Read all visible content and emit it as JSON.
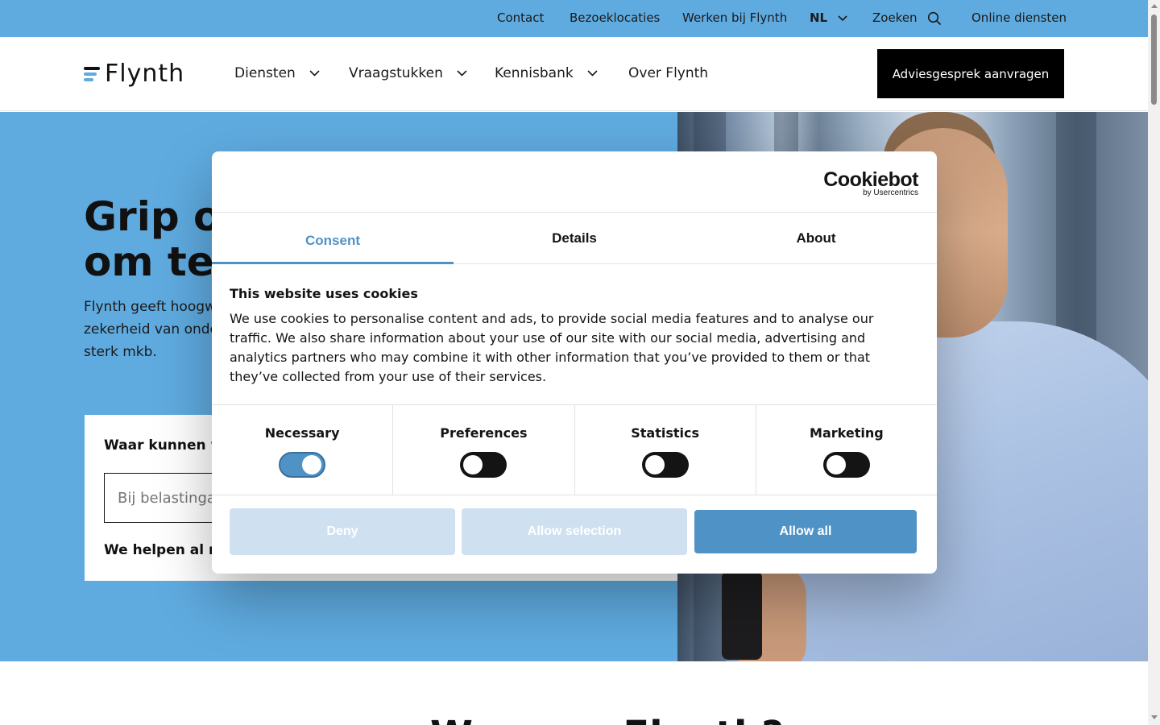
{
  "topbar": {
    "contact": "Contact",
    "locations": "Bezoeklocaties",
    "careers": "Werken bij Flynth",
    "language": "NL",
    "search": "Zoeken",
    "online_services": "Online diensten"
  },
  "header": {
    "logo_text": "Flynth",
    "nav": {
      "services": "Diensten",
      "questions": "Vraagstukken",
      "knowledge": "Kennisbank",
      "about": "Over Flynth"
    },
    "cta": "Adviesgesprek aanvragen"
  },
  "hero": {
    "title_line1": "Grip o",
    "title_line2": "om te",
    "subtitle_line1": "Flynth geeft hoogwa",
    "subtitle_line2": "zekerheid van onde",
    "subtitle_line3": "sterk mkb.",
    "card_question": "Waar kunnen we",
    "search_placeholder": "Bij belastingac",
    "card_help": "We helpen al me"
  },
  "below": {
    "title": "Waarom Flynth?"
  },
  "cookie_dialog": {
    "brand": "Cookiebot",
    "brand_sub": "by Usercentrics",
    "tabs": [
      "Consent",
      "Details",
      "About"
    ],
    "active_tab": "Consent",
    "title": "This website uses cookies",
    "body": "We use cookies to personalise content and ads, to provide social media features and to analyse our traffic. We also share information about your use of our site with our social media, advertising and analytics partners who may combine it with other information that you’ve provided to them or that they’ve collected from your use of their services.",
    "categories": [
      {
        "label": "Necessary",
        "enabled": true
      },
      {
        "label": "Preferences",
        "enabled": false
      },
      {
        "label": "Statistics",
        "enabled": false
      },
      {
        "label": "Marketing",
        "enabled": false
      }
    ],
    "buttons": {
      "deny": "Deny",
      "allow_selection": "Allow selection",
      "allow_all": "Allow all"
    }
  },
  "colors": {
    "brand_blue": "#5fabe0",
    "cookie_accent": "#4f92c6",
    "disabled_button": "#cfe1f1"
  }
}
